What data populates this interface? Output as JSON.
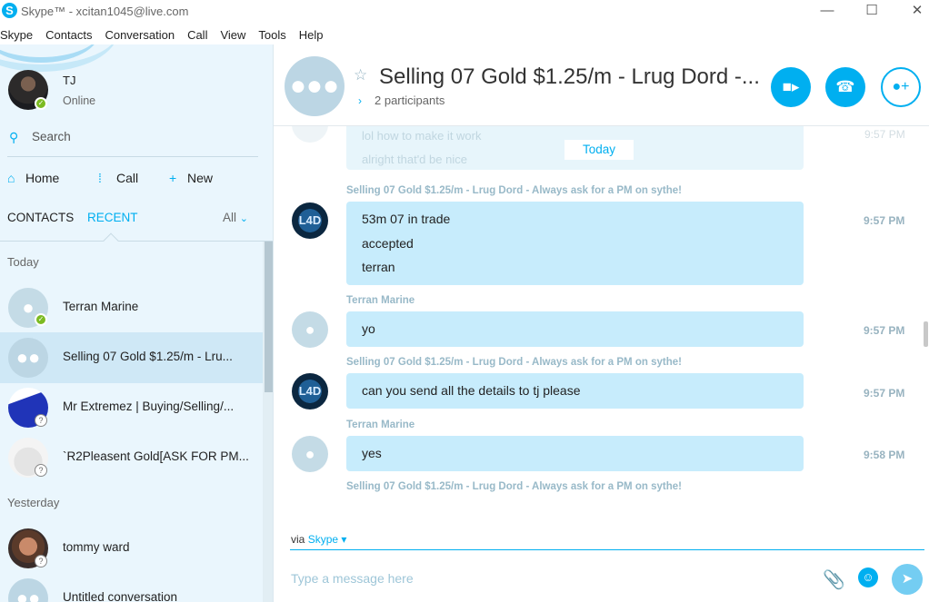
{
  "window": {
    "title": "Skype™ - xcitan1045@live.com",
    "app_icon": "skype-logo-icon",
    "controls": {
      "minimize": "—",
      "maximize": "☐",
      "close": "✕"
    }
  },
  "menu": [
    "Skype",
    "Contacts",
    "Conversation",
    "Call",
    "View",
    "Tools",
    "Help"
  ],
  "profile": {
    "name": "TJ",
    "status": "Online"
  },
  "search": {
    "label": "Search"
  },
  "actions": {
    "home": "Home",
    "call": "Call",
    "new": "New"
  },
  "tabs": {
    "contacts": "CONTACTS",
    "recent": "RECENT",
    "filter": "All"
  },
  "groups": {
    "today": "Today",
    "yesterday": "Yesterday"
  },
  "recent_items": [
    {
      "name": "Terran Marine",
      "avatar": "person",
      "status": "online"
    },
    {
      "name": "Selling 07 Gold $1.25/m - Lru...",
      "avatar": "group",
      "status": "none",
      "selected": true
    },
    {
      "name": "Mr Extremez | Buying/Selling/...",
      "avatar": "image",
      "status": "unknown"
    },
    {
      "name": "`R2Pleasent Gold[ASK FOR PM...",
      "avatar": "image",
      "status": "unknown"
    },
    {
      "name": "tommy ward",
      "avatar": "photo",
      "status": "unknown"
    },
    {
      "name": "Untitled conversation",
      "avatar": "group",
      "status": "none"
    }
  ],
  "conversation": {
    "title": "Selling 07 Gold $1.25/m - Lrug Dord -...",
    "participants": "2 participants",
    "faded_lines": [
      "lol how to make it work",
      "alright that'd be nice"
    ],
    "faded_time": "9:57 PM",
    "day_separator": "Today",
    "messages": [
      {
        "sender": "Selling 07 Gold $1.25/m - Lrug Dord - Always ask for a PM on sythe!",
        "lines": [
          "53m 07 in trade",
          "accepted",
          "terran"
        ],
        "time": "9:57 PM",
        "avatar": "logo"
      },
      {
        "sender": "Terran Marine",
        "lines": [
          "yo"
        ],
        "time": "9:57 PM",
        "avatar": "person"
      },
      {
        "sender": "Selling 07 Gold $1.25/m - Lrug Dord - Always ask for a PM on sythe!",
        "lines": [
          "can you send all the details to tj please"
        ],
        "time": "9:57 PM",
        "avatar": "logo"
      },
      {
        "sender": "Terran Marine",
        "lines": [
          "yes"
        ],
        "time": "9:58 PM",
        "avatar": "person"
      }
    ],
    "typing_sender": "Selling 07 Gold $1.25/m - Lrug Dord - Always ask for a PM on sythe!"
  },
  "compose": {
    "via_prefix": "via",
    "via_service": "Skype",
    "placeholder": "Type a message here"
  },
  "logo_text": "L4D",
  "colors": {
    "accent": "#00aff0",
    "bubble": "#c7ecfc",
    "sidebar": "#eaf6fd",
    "online": "#7cbb22"
  }
}
